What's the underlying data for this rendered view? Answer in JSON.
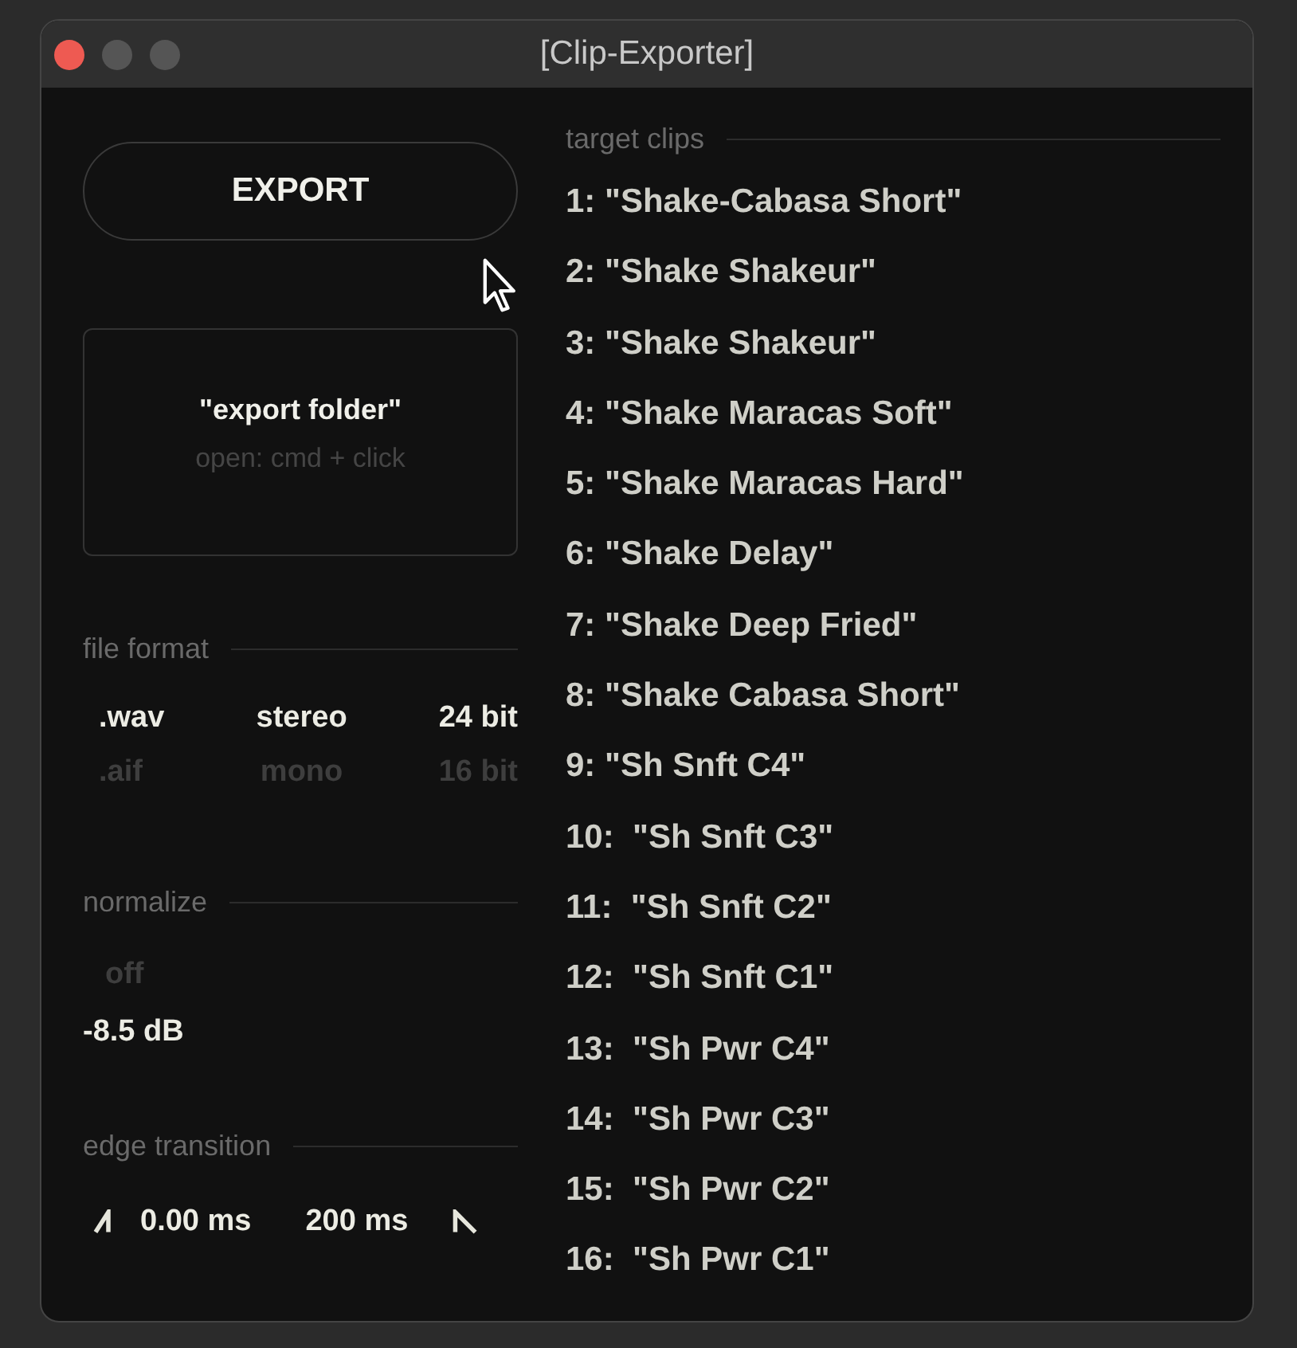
{
  "window": {
    "title": "[Clip-Exporter]"
  },
  "export_button": {
    "label": "EXPORT"
  },
  "folder": {
    "name": "\"export folder\"",
    "hint": "open: cmd + click"
  },
  "file_format": {
    "title": "file format",
    "columns": [
      {
        "options": [
          {
            "label": ".wav",
            "selected": true
          },
          {
            "label": ".aif",
            "selected": false
          }
        ]
      },
      {
        "options": [
          {
            "label": "stereo",
            "selected": true
          },
          {
            "label": "mono",
            "selected": false
          }
        ]
      },
      {
        "options": [
          {
            "label": "24 bit",
            "selected": true
          },
          {
            "label": "16 bit",
            "selected": false
          }
        ]
      }
    ]
  },
  "normalize": {
    "title": "normalize",
    "options": [
      {
        "label": "off",
        "selected": false
      },
      {
        "label": "-8.5 dB",
        "selected": true
      }
    ]
  },
  "edge_transition": {
    "title": "edge transition",
    "fade_in": "0.00 ms",
    "fade_out": "200 ms"
  },
  "target_clips": {
    "title": "target clips",
    "items": [
      "1: \"Shake-Cabasa Short\"",
      "2: \"Shake Shakeur\"",
      "3: \"Shake Shakeur\"",
      "4: \"Shake Maracas Soft\"",
      "5: \"Shake Maracas Hard\"",
      "6: \"Shake Delay\"",
      "7: \"Shake Deep Fried\"",
      "8: \"Shake Cabasa Short\"",
      "9: \"Sh Snft C4\"",
      "10:  \"Sh Snft C3\"",
      "11:  \"Sh Snft C2\"",
      "12:  \"Sh Snft C1\"",
      "13:  \"Sh Pwr C4\"",
      "14:  \"Sh Pwr C3\"",
      "15:  \"Sh Pwr C2\"",
      "16:  \"Sh Pwr C1\""
    ]
  }
}
